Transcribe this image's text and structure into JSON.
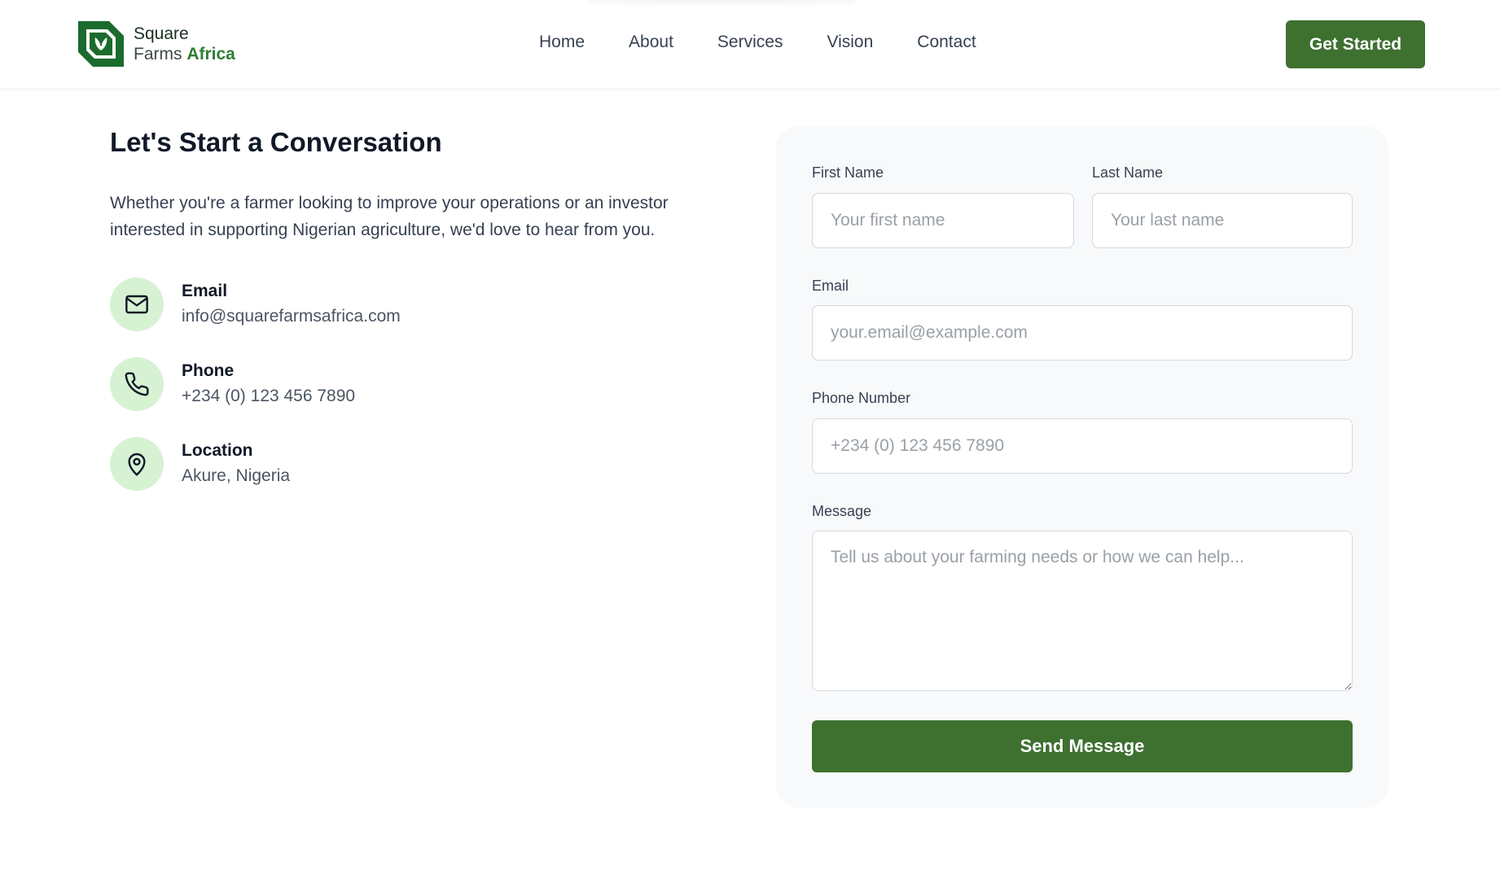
{
  "header": {
    "logo_line1": "Square",
    "logo_line2_prefix": "Farms ",
    "logo_line2_accent": "Africa",
    "nav": {
      "home": "Home",
      "about": "About",
      "services": "Services",
      "vision": "Vision",
      "contact": "Contact"
    },
    "cta_label": "Get Started"
  },
  "main": {
    "heading": "Let's Start a Conversation",
    "intro": "Whether you're a farmer looking to improve your operations or an investor interested in supporting Nigerian agriculture, we'd love to hear from you.",
    "contacts": {
      "email": {
        "label": "Email",
        "value": "info@squarefarmsafrica.com",
        "icon": "mail-icon"
      },
      "phone": {
        "label": "Phone",
        "value": "+234 (0) 123 456 7890",
        "icon": "phone-icon"
      },
      "location": {
        "label": "Location",
        "value": "Akure, Nigeria",
        "icon": "map-pin-icon"
      }
    }
  },
  "form": {
    "first_name": {
      "label": "First Name",
      "placeholder": "Your first name",
      "value": ""
    },
    "last_name": {
      "label": "Last Name",
      "placeholder": "Your last name",
      "value": ""
    },
    "email": {
      "label": "Email",
      "placeholder": "your.email@example.com",
      "value": ""
    },
    "phone": {
      "label": "Phone Number",
      "placeholder": "+234 (0) 123 456 7890",
      "value": ""
    },
    "message": {
      "label": "Message",
      "placeholder": "Tell us about your farming needs or how we can help...",
      "value": ""
    },
    "submit_label": "Send Message"
  },
  "colors": {
    "brand_green": "#3e7030",
    "logo_green": "#1b6b2e",
    "icon_bg": "#d6f2d3",
    "card_bg": "#f8f9fa"
  }
}
